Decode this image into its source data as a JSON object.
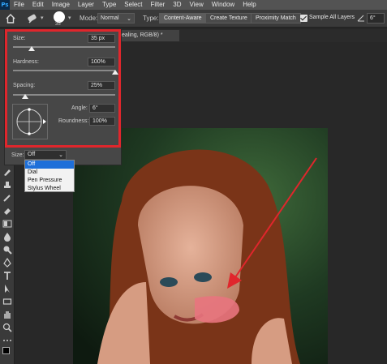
{
  "menu": {
    "logo": "Ps",
    "items": [
      "File",
      "Edit",
      "Image",
      "Layer",
      "Type",
      "Select",
      "Filter",
      "3D",
      "View",
      "Window",
      "Help"
    ]
  },
  "options": {
    "brush_size": "35",
    "mode_label": "Mode:",
    "mode_value": "Normal",
    "type_label": "Type:",
    "type_buttons": [
      "Content-Aware",
      "Create Texture",
      "Proximity Match"
    ],
    "sample_all_layers": "Sample All Layers",
    "angle_value": "6°"
  },
  "document_tab": {
    "title": "ealing, RGB/8) *"
  },
  "brush_panel": {
    "size_label": "Size:",
    "size_value": "35 px",
    "size_level": 0.18,
    "hardness_label": "Hardness:",
    "hardness_value": "100%",
    "hardness_level": 1.0,
    "spacing_label": "Spacing:",
    "spacing_value": "25%",
    "spacing_level": 0.12,
    "angle_label": "Angle:",
    "angle_value": "6°",
    "roundness_label": "Roundness:",
    "roundness_value": "100%",
    "size_control_label": "Size:",
    "size_control_value": "Off"
  },
  "dropdown": {
    "options": [
      "Off",
      "Dial",
      "Pen Pressure",
      "Stylus Wheel"
    ],
    "selected_index": 0
  },
  "colors": {
    "highlight": "#e0262c",
    "arrow": "#e0262c",
    "paint_stroke": "#e8747e",
    "selection": "#1e6fd9"
  }
}
